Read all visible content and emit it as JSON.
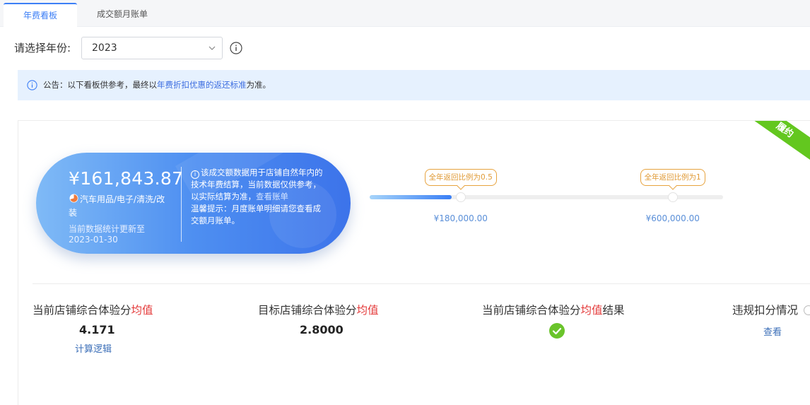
{
  "tabs": [
    {
      "label": "年费看板",
      "active": true
    },
    {
      "label": "成交额月账单",
      "active": false
    }
  ],
  "year_filter": {
    "label": "请选择年份:",
    "selected": "2023"
  },
  "notice": {
    "prefix": "公告：以下看板供参考，最终以",
    "link": "年费折扣优惠的返还标准",
    "suffix": "为准。"
  },
  "ribbon": {
    "text": "履约"
  },
  "summary": {
    "amount": "¥161,843.87",
    "category": "汽车用品/电子/清洗/改装",
    "update_label": "当前数据统计更新至",
    "update_date": "2023-01-30",
    "desc_text": "该成交额数据用于店铺自然年内的技术年费结算，当前数据仅供参考，以实际结算为准，",
    "desc_link": "查看账单",
    "tip_text": "温馨提示：月度账单明细请您查看成交额月账单。"
  },
  "progress": {
    "current_amount": 161843.87,
    "track_max": 700000,
    "milestones": [
      {
        "label": "全年返回比例为0.5",
        "amount": "¥180,000.00",
        "value": 180000
      },
      {
        "label": "全年返回比例为1",
        "amount": "¥600,000.00",
        "value": 600000
      }
    ]
  },
  "stats": [
    {
      "title": "当前店铺综合体验分",
      "highlight": "均值",
      "value": "4.171",
      "link": "计算逻辑"
    },
    {
      "title": "目标店铺综合体验分",
      "highlight": "均值",
      "value": "2.8000"
    },
    {
      "title": "当前店铺综合体验分",
      "highlight": "均值",
      "suffix": "结果",
      "result": "passed"
    },
    {
      "title": "违规扣分情况",
      "link": "查看"
    }
  ],
  "colors": {
    "accent": "#3d7ff6",
    "highlight": "#e43b3b",
    "success": "#6ac42b",
    "warning": "#e7a33e"
  }
}
